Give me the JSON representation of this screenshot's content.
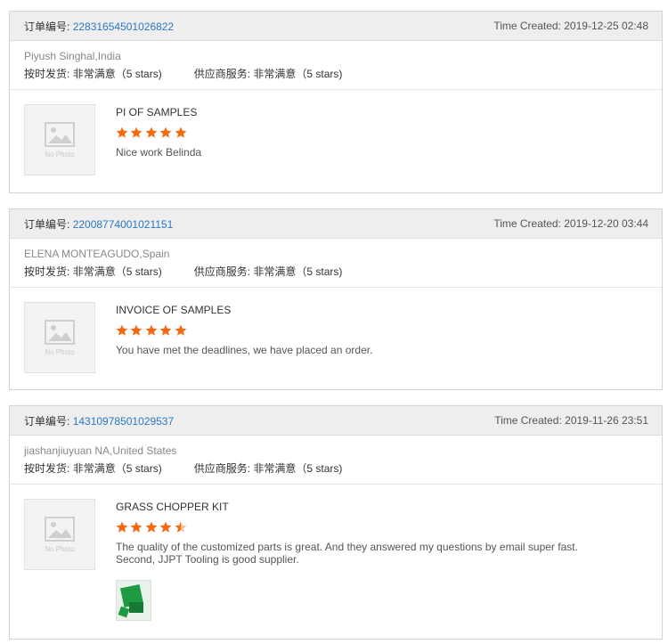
{
  "labels": {
    "order_label": "订单编号:",
    "time_created_label": "Time Created:",
    "ship_label": "按时发货:",
    "service_label": "供应商服务:",
    "no_photo": "No Photo"
  },
  "colors": {
    "link": "#2a78c5",
    "star_filled": "#f36a10",
    "star_empty": "#f3c3a0"
  },
  "reviews": [
    {
      "order_no": "22831654501026822",
      "time_created": "2019-12-25 02:48",
      "buyer": "Piyush Singhal,India",
      "ship_rating": "非常满意（5 stars)",
      "service_rating": "非常满意（5 stars)",
      "product": "PI OF SAMPLES",
      "stars": 5,
      "comment": "Nice work Belinda"
    },
    {
      "order_no": "22008774001021151",
      "time_created": "2019-12-20 03:44",
      "buyer": "ELENA MONTEAGUDO,Spain",
      "ship_rating": "非常满意（5 stars)",
      "service_rating": "非常满意（5 stars)",
      "product": "INVOICE OF SAMPLES",
      "stars": 5,
      "comment": "You have met the deadlines, we have placed an order."
    },
    {
      "order_no": "14310978501029537",
      "time_created": "2019-11-26 23:51",
      "buyer": "jiashanjiuyuan NA,United States",
      "ship_rating": "非常满意（5 stars)",
      "service_rating": "非常满意（5 stars)",
      "product": "GRASS CHOPPER KIT",
      "stars": 4.5,
      "comment": "The quality of the customized parts is great. And they answered my questions by email super fast. Second, JJPT Tooling is good supplier.",
      "attachment": "green-part-photo"
    }
  ]
}
